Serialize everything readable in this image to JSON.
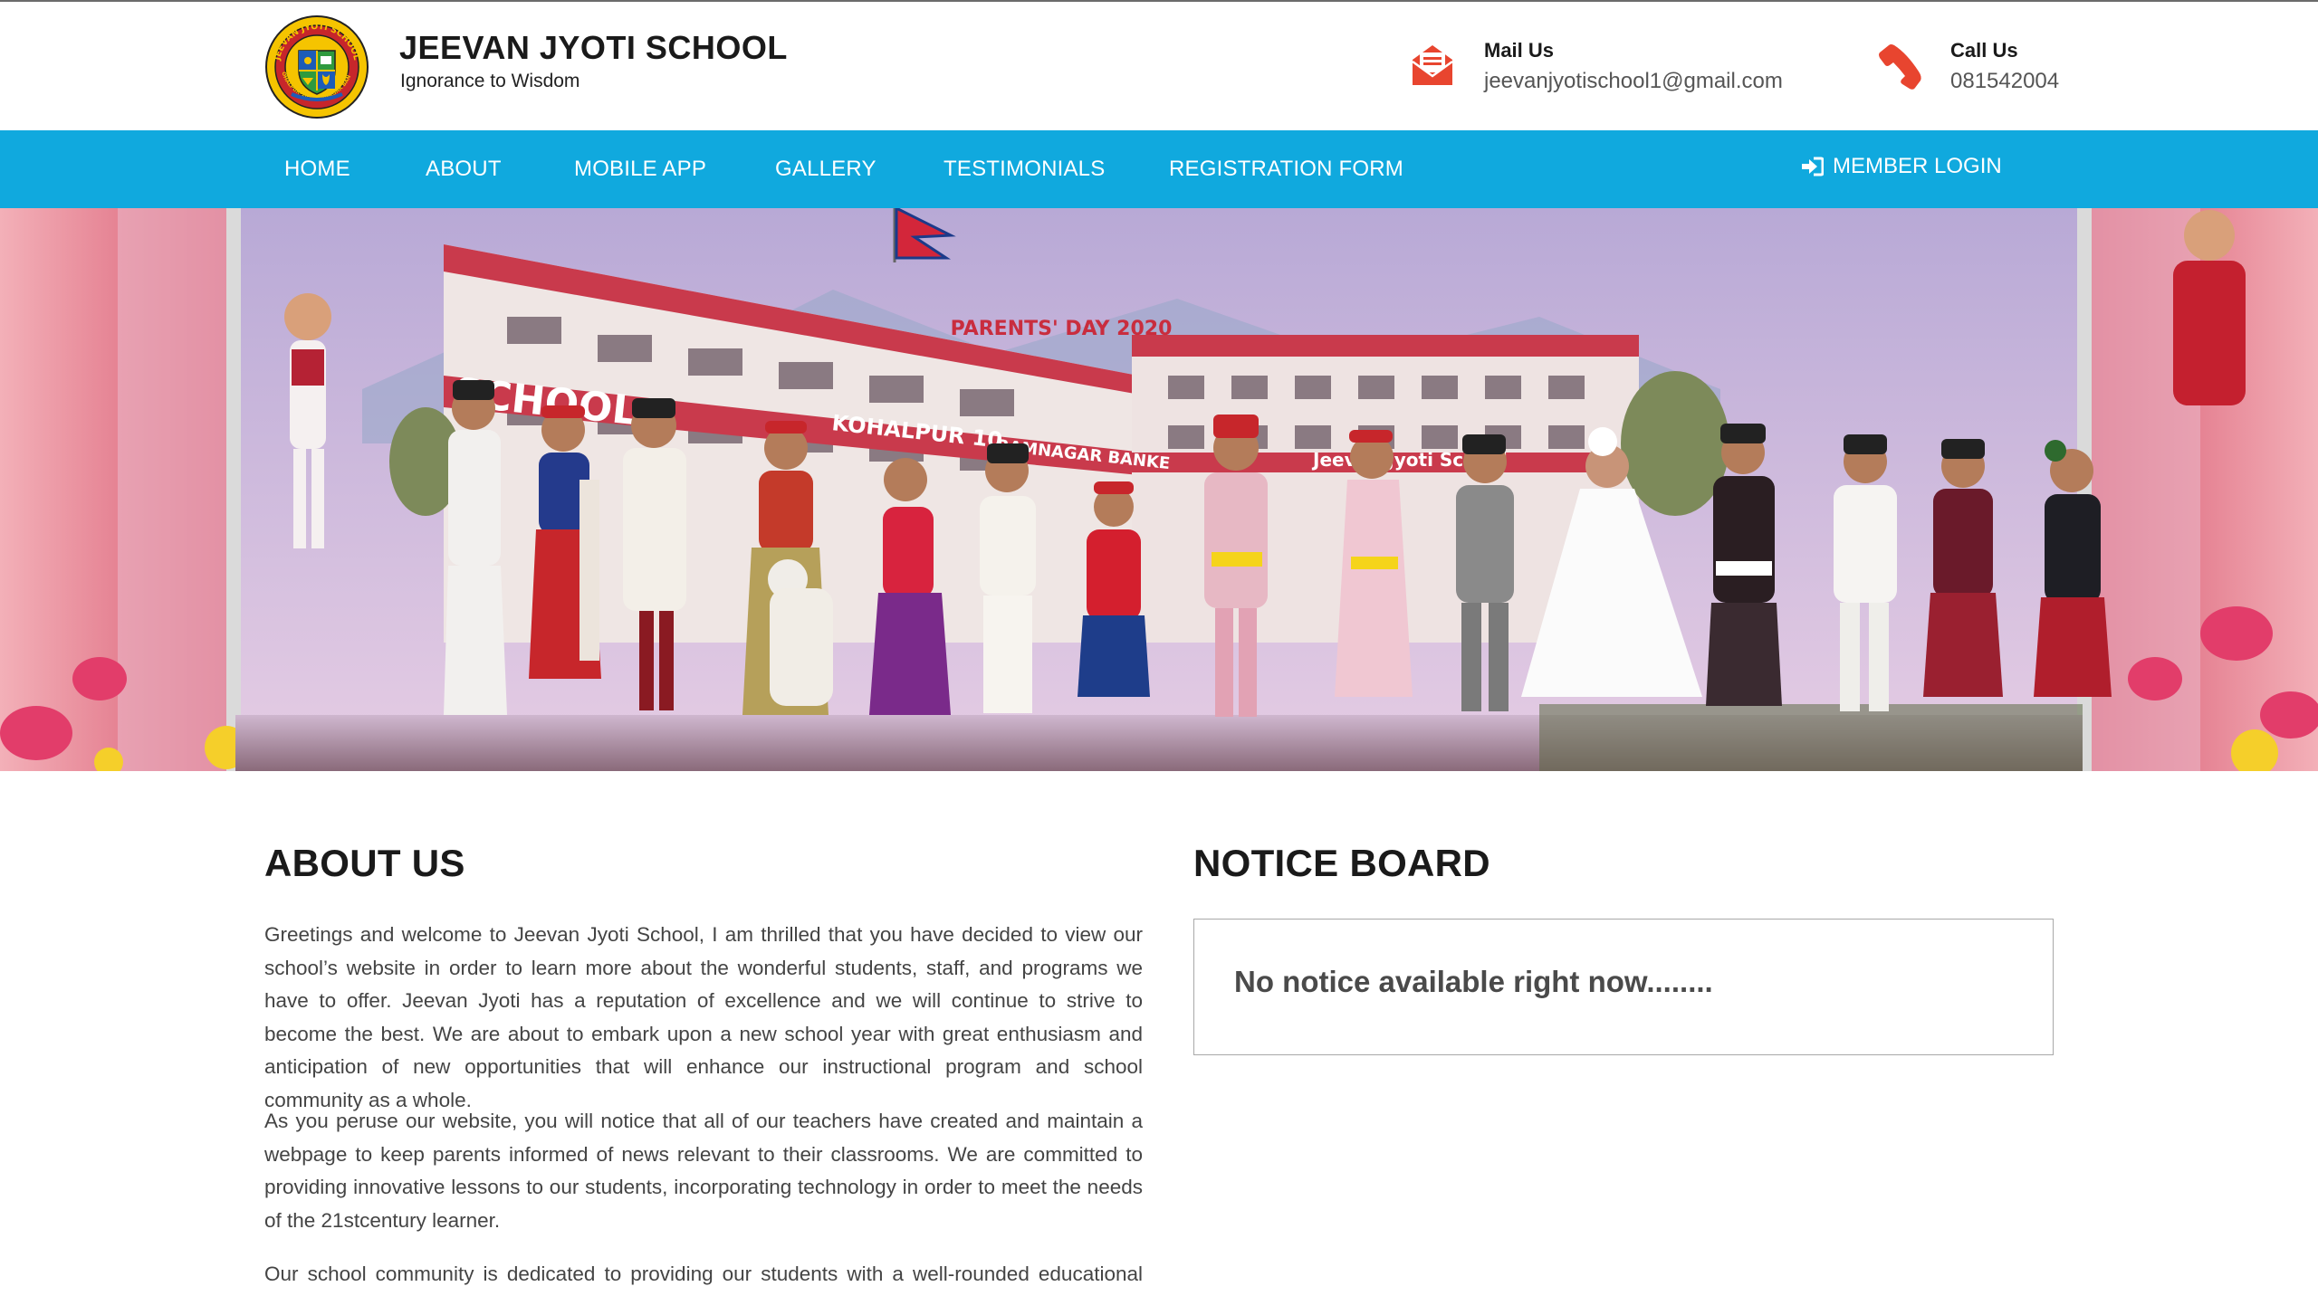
{
  "header": {
    "school_name": "JEEVAN JYOTI SCHOOL",
    "tagline": "Ignorance to Wisdom",
    "logo": {
      "ring_text": "JEEVAN JYOTI SCHOOL",
      "bottom_text": "KOHALPUR-10, RAMNAGAR BANKE"
    },
    "mail": {
      "label": "Mail Us",
      "value": "jeevanjyotischool1@gmail.com",
      "icon": "envelope-icon"
    },
    "call": {
      "label": "Call Us",
      "value": "081542004",
      "icon": "phone-icon"
    }
  },
  "nav": {
    "items": [
      {
        "label": "HOME"
      },
      {
        "label": "ABOUT"
      },
      {
        "label": "MOBILE APP"
      },
      {
        "label": "GALLERY"
      },
      {
        "label": "TESTIMONIALS"
      },
      {
        "label": "REGISTRATION FORM"
      }
    ],
    "login": {
      "label": "MEMBER LOGIN",
      "icon": "sign-in-icon"
    }
  },
  "hero": {
    "banner_text": "PARENTS' DAY 2020",
    "building_text": "SCHOOL",
    "sign_text_1": "KOHALPUR 10",
    "sign_text_2": "RAMNAGAR BANKE",
    "sign_text_3": "Jeevan Jyoti School"
  },
  "about": {
    "title": "ABOUT US",
    "paragraphs": [
      "Greetings and welcome to Jeevan Jyoti School, I am thrilled that you have decided to view our school’s website in order to learn more about the wonderful students, staff, and programs we have to offer. Jeevan Jyoti has a reputation of excellence and we will continue to strive to become the best. We are about to embark upon a new school year with great enthusiasm and anticipation of new opportunities that will enhance our instructional program and school community as a whole.",
      "As you peruse our website, you will notice that all of our teachers have created and maintain a webpage to keep parents informed of news relevant to their classrooms. We are committed to providing innovative lessons to our students, incorporating technology in order to meet the needs of the 21stcentury learner.",
      "Our school community is dedicated to providing our students with a well-rounded educational"
    ]
  },
  "notice": {
    "title": "NOTICE BOARD",
    "empty_text": "No notice available right now........"
  },
  "colors": {
    "nav_bg": "#10a9de",
    "icon_red": "#e8452f",
    "text_dark": "#1a1a1a"
  }
}
